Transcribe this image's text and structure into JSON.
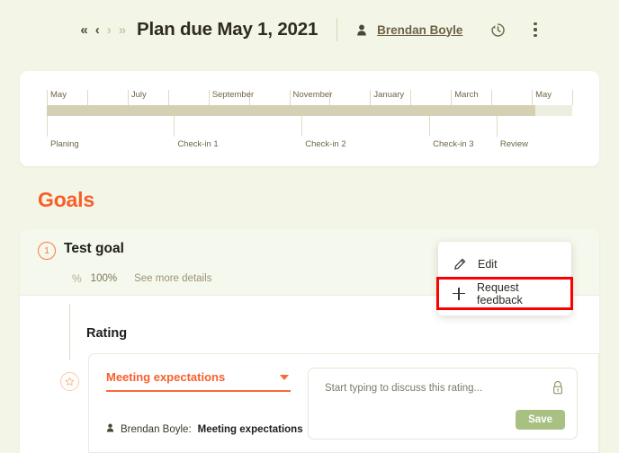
{
  "header": {
    "nav": [
      {
        "label": "«",
        "name": "nav-first",
        "state": "active"
      },
      {
        "label": "‹",
        "name": "nav-prev",
        "state": "active"
      },
      {
        "label": "›",
        "name": "nav-next",
        "state": "disabled"
      },
      {
        "label": "»",
        "name": "nav-last",
        "state": "disabled"
      }
    ],
    "title": "Plan due May 1, 2021",
    "owner": "Brendan Boyle",
    "history_icon": "history-clock-icon",
    "more_icon": "kebab-menu-icon",
    "person_icon": "person-icon"
  },
  "timeline": {
    "months": [
      "May",
      "July",
      "September",
      "November",
      "January",
      "March",
      "May"
    ],
    "progress_percent": 93,
    "milestones": [
      {
        "label": "Planing",
        "position": 0
      },
      {
        "label": "Check-in 1",
        "position": 24.2
      },
      {
        "label": "Check-in 2",
        "position": 48.5
      },
      {
        "label": "Check-in 3",
        "position": 72.8
      },
      {
        "label": "Review",
        "position": 85.6
      }
    ],
    "bar_fill_color": "#d4d0b3",
    "bar_track_color": "#eceee0"
  },
  "goals": {
    "section_title": "Goals",
    "section_title_color": "#fa5d29",
    "goal": {
      "number": "1",
      "name": "Test goal",
      "percent_symbol": "%",
      "percent_value": "100%",
      "details_link": "See more details"
    },
    "rating": {
      "title": "Rating",
      "selected_value": "Meeting expectations",
      "select_color": "#fa5f2b",
      "star_icon": "star-circle-icon",
      "rater_prefix": "Brendan Boyle:",
      "rater_value": "Meeting expectations",
      "comment_placeholder": "Start typing to discuss this rating...",
      "lock_icon": "lock-icon",
      "save_label": "Save",
      "save_color": "#a8c183"
    }
  },
  "menu": {
    "items": [
      {
        "label": "Edit",
        "icon": "pencil-icon",
        "highlighted": false
      },
      {
        "label": "Request feedback",
        "icon": "plus-icon",
        "highlighted": true
      }
    ],
    "highlight_color": "#fb0000"
  }
}
